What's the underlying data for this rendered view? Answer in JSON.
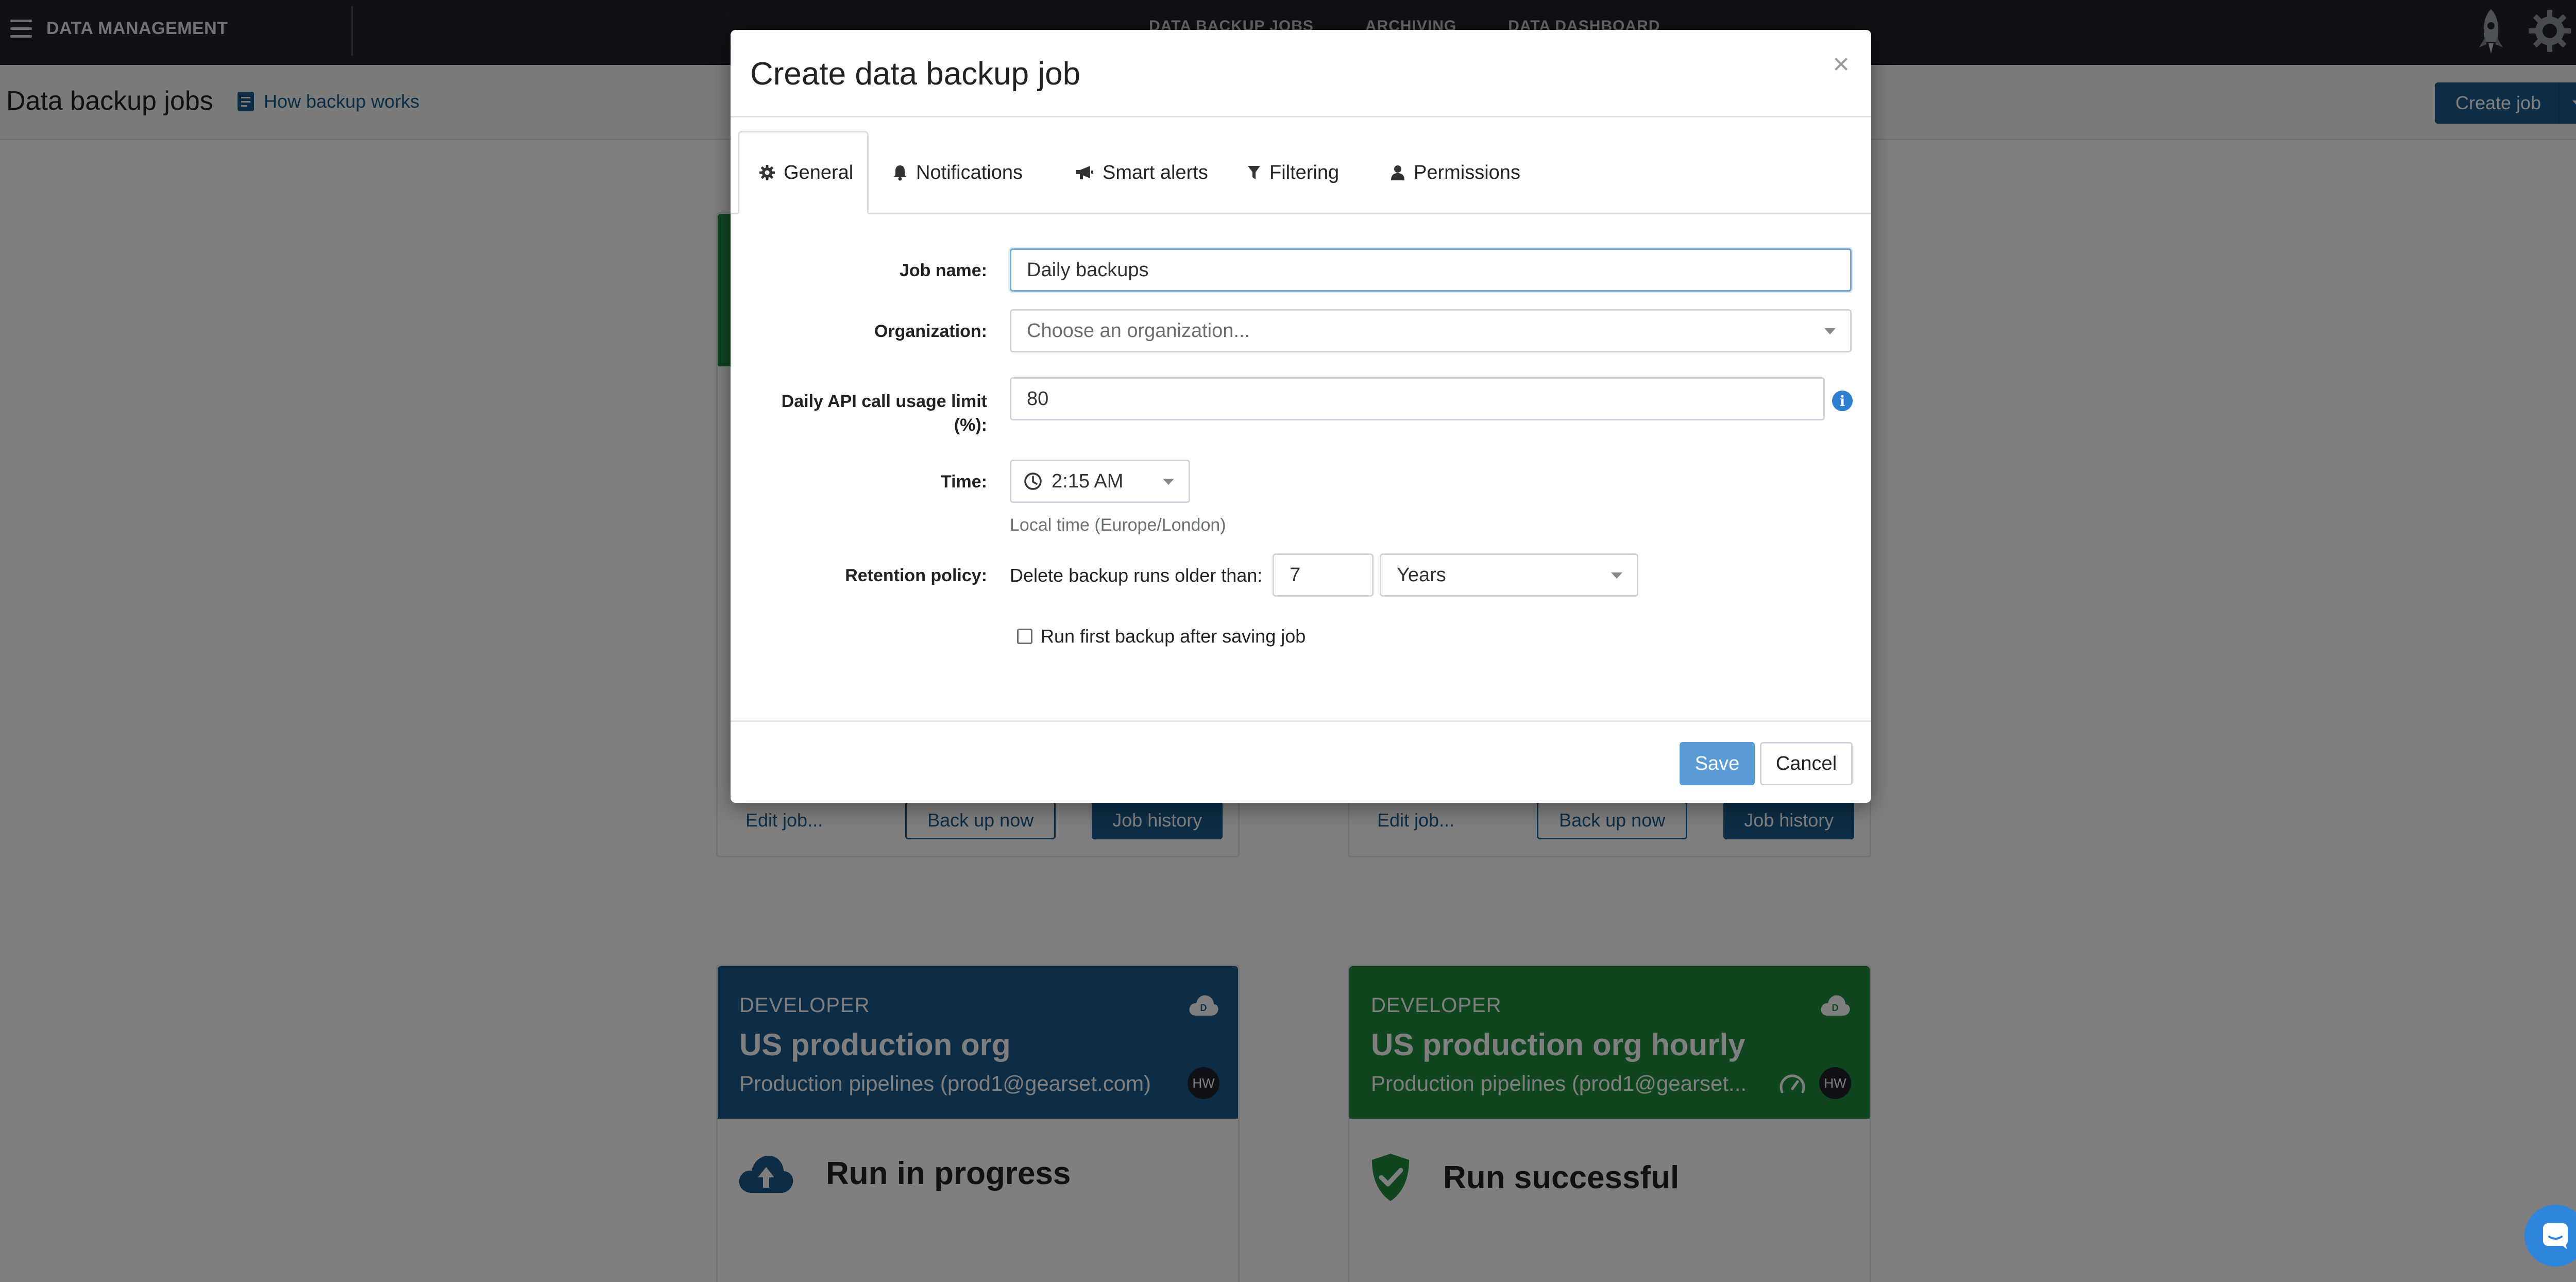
{
  "nav": {
    "brand": "DATA MANAGEMENT",
    "links": [
      "DATA BACKUP JOBS",
      "ARCHIVING",
      "DATA DASHBOARD"
    ],
    "icons": {
      "menu": "hamburger-menu-icon",
      "rocket": "rocket-icon",
      "settings": "gear-icon"
    }
  },
  "header": {
    "title": "Data backup jobs",
    "how_link": "How backup works",
    "create_button": "Create job"
  },
  "cards": [
    {
      "tier": "DEVELOPER",
      "title": "US production org",
      "subtitle": "Production pipelines (prod1@gearset.com)",
      "avatar": "HW",
      "status": "Run in progress",
      "color": "#1a5a8c"
    },
    {
      "tier": "DEVELOPER",
      "title": "US production org hourly",
      "subtitle": "Production pipelines (prod1@gearset...",
      "avatar": "HW",
      "status": "Run successful",
      "color": "#1e8a3f"
    }
  ],
  "card_actions": {
    "edit": "Edit job...",
    "backup": "Back up now",
    "history": "Job history"
  },
  "modal": {
    "title": "Create data backup job",
    "close": "×",
    "tabs": [
      "General",
      "Notifications",
      "Smart alerts",
      "Filtering",
      "Permissions"
    ],
    "active_tab": "General",
    "form": {
      "job_name_label": "Job name:",
      "job_name_value": "Daily backups",
      "organization_label": "Organization:",
      "organization_placeholder": "Choose an organization...",
      "api_limit_label_line1": "Daily API call usage limit",
      "api_limit_label_line2": "(%):",
      "api_limit_value": "80",
      "time_label": "Time:",
      "time_value": "2:15 AM",
      "time_help": "Local time (Europe/London)",
      "retention_label": "Retention policy:",
      "retention_text": "Delete backup runs older than:",
      "retention_value": "7",
      "retention_unit": "Years",
      "run_first_label": "Run first backup after saving job"
    },
    "save": "Save",
    "cancel": "Cancel"
  },
  "colors": {
    "primary": "#1a5a8c",
    "success": "#1e8a3f",
    "nav_bg": "#1e2328",
    "save_disabled": "#5b9bd5"
  }
}
